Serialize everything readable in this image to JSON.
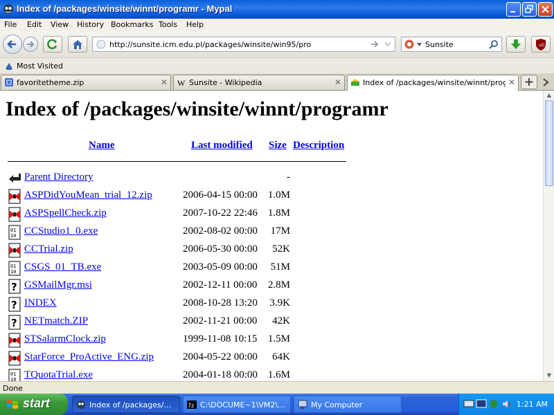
{
  "window": {
    "title": "Index of /packages/winsite/winnt/programr - Mypal"
  },
  "menu": [
    "File",
    "Edit",
    "View",
    "History",
    "Bookmarks",
    "Tools",
    "Help"
  ],
  "nav": {
    "url": "http://sunsite.icm.edu.pl/packages/winsite/win95/pro",
    "search_engine": "Sunsite"
  },
  "bookmarks": {
    "most_visited": "Most Visited"
  },
  "tabs": [
    {
      "label": "favoritetheme.zip"
    },
    {
      "label": "Sunsite - Wikipedia"
    },
    {
      "label": "Index of /packages/winsite/winnt/progra..."
    }
  ],
  "page": {
    "heading": "Index of /packages/winsite/winnt/programr",
    "columns": {
      "name": "Name",
      "modified": "Last modified",
      "size": "Size",
      "description": "Description"
    },
    "rows": [
      {
        "icon": "back-icon",
        "name": "Parent Directory",
        "modified": "",
        "size": "-"
      },
      {
        "icon": "compressed-icon",
        "name": "ASPDidYouMean_trial_12.zip",
        "modified": "2006-04-15 00:00",
        "size": "1.0M"
      },
      {
        "icon": "compressed-icon",
        "name": "ASPSpellCheck.zip",
        "modified": "2007-10-22 22:46",
        "size": "1.8M"
      },
      {
        "icon": "binary-icon",
        "name": "CCStudio1_0.exe",
        "modified": "2002-08-02 00:00",
        "size": "17M"
      },
      {
        "icon": "compressed-icon",
        "name": "CCTrial.zip",
        "modified": "2006-05-30 00:00",
        "size": "52K"
      },
      {
        "icon": "binary-icon",
        "name": "CSGS_01_TB.exe",
        "modified": "2003-05-09 00:00",
        "size": "51M"
      },
      {
        "icon": "unknown-icon",
        "name": "GSMailMgr.msi",
        "modified": "2002-12-11 00:00",
        "size": "2.8M"
      },
      {
        "icon": "unknown-icon",
        "name": "INDEX",
        "modified": "2008-10-28 13:20",
        "size": "3.9K"
      },
      {
        "icon": "unknown-icon",
        "name": "NETmatch.ZIP",
        "modified": "2002-11-21 00:00",
        "size": "42K"
      },
      {
        "icon": "compressed-icon",
        "name": "STSalarmClock.zip",
        "modified": "1999-11-08 10:15",
        "size": "1.5M"
      },
      {
        "icon": "compressed-icon",
        "name": "StarForce_ProActive_ENG.zip",
        "modified": "2004-05-22 00:00",
        "size": "64K"
      },
      {
        "icon": "binary-icon",
        "name": "TQuotaTrial.exe",
        "modified": "2004-01-18 00:00",
        "size": "1.6M"
      }
    ]
  },
  "status": {
    "text": "Done"
  },
  "taskbar": {
    "start": "start",
    "tasks": [
      "Index of /packages/...",
      "C:\\DOCUME~1\\VM2\\...",
      "My Computer"
    ],
    "clock": "1:21 AM"
  },
  "colors": {
    "link": "#0000EE",
    "titlebar": "#0A5FD8",
    "taskbar": "#245DDB",
    "start": "#3B9A3B"
  }
}
